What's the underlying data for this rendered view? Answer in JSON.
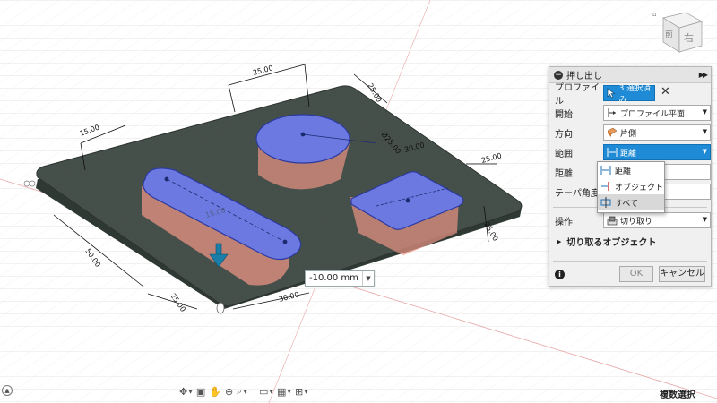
{
  "viewcube": {
    "face_right": "右",
    "face_front": "前"
  },
  "dimensions": {
    "top_width": "25.00",
    "top_right": "25.00",
    "left_width": "15.00",
    "circle_dia": "Ø25.00",
    "rect_side1": "25.00",
    "rect_side2": "25.00",
    "slot_center": "15.00",
    "slot_length": "50.00",
    "bottom_1": "25.00",
    "bottom_2": "30.00",
    "mid_label": "30.00"
  },
  "distance_input": {
    "value": "-10.00 mm"
  },
  "panel": {
    "title": "押し出し",
    "rows": {
      "profile": {
        "label": "プロファイル",
        "value": "3 選択済み"
      },
      "start": {
        "label": "開始",
        "value": "プロファイル平面"
      },
      "direction": {
        "label": "方向",
        "value": "片側"
      },
      "extent": {
        "label": "範囲",
        "value": "距離"
      },
      "distance": {
        "label": "距離"
      },
      "taper": {
        "label": "テーパ角度"
      },
      "operation": {
        "label": "操作",
        "value": "切り取り"
      }
    },
    "dropdown_options": [
      "距離",
      "オブジェクト",
      "すべて"
    ],
    "section_cut": "切り取るオブジェクト",
    "ok": "OK",
    "cancel": "キャンセル",
    "info": "i"
  },
  "status": {
    "text": "複数選択"
  },
  "colors": {
    "plate_top": "#46504b",
    "plate_side": "#36403b",
    "selection_blue": "#6b79e0",
    "cut_red": "#e89383",
    "accent": "#1f8bd6"
  }
}
